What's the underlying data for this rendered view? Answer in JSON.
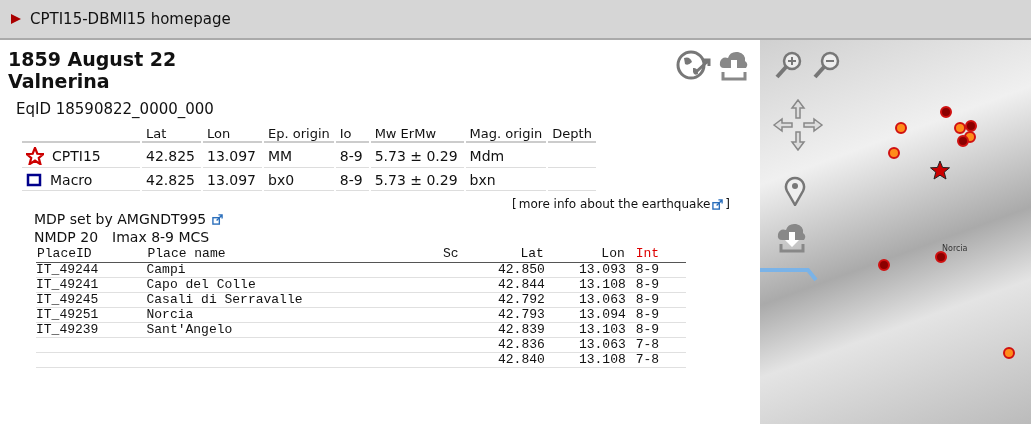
{
  "window": {
    "title": "CPTI15-DBMI15 homepage"
  },
  "event": {
    "date": "1859 August 22",
    "area": "Valnerina",
    "eqid": "EqID 18590822_0000_000"
  },
  "params": {
    "columns": [
      "Lat",
      "Lon",
      "Ep. origin",
      "Io",
      "Mw   ErMw",
      "Mag. origin",
      "Depth"
    ],
    "rows": [
      {
        "kind": "star",
        "name": "CPTI15",
        "cells": [
          "42.825",
          "13.097",
          "MM",
          "8-9",
          "5.73 ± 0.29",
          "Mdm",
          ""
        ]
      },
      {
        "kind": "square",
        "name": "Macro",
        "cells": [
          "42.825",
          "13.097",
          "bx0",
          "8-9",
          "5.73 ± 0.29",
          "bxn",
          ""
        ]
      }
    ]
  },
  "more_info": {
    "open": "[",
    "link": "more info about the earthquake",
    "close": "]"
  },
  "mdp": {
    "set_by": "MDP set by AMGNDT995",
    "nmdp": "NMDP 20",
    "imax": "Imax 8-9 MCS"
  },
  "places": {
    "columns": [
      "PlaceID",
      "Place name",
      "Sc",
      "Lat",
      "Lon",
      "Int"
    ],
    "rows": [
      {
        "id": "IT_49244",
        "name": "Campi",
        "lat": "42.850",
        "lon": "13.093",
        "int": "8-9"
      },
      {
        "id": "IT_49241",
        "name": "Capo del Colle",
        "lat": "42.844",
        "lon": "13.108",
        "int": "8-9"
      },
      {
        "id": "IT_49245",
        "name": "Casali di Serravalle",
        "lat": "42.792",
        "lon": "13.063",
        "int": "8-9"
      },
      {
        "id": "IT_49251",
        "name": "Norcia",
        "lat": "42.793",
        "lon": "13.094",
        "int": "8-9"
      },
      {
        "id": "IT_49239",
        "name": "Sant'Angelo",
        "lat": "42.839",
        "lon": "13.103",
        "int": "8-9"
      },
      {
        "id": "",
        "name": "",
        "lat": "42.836",
        "lon": "13.063",
        "int": "7-8"
      },
      {
        "id": "",
        "name": "",
        "lat": "42.840",
        "lon": "13.108",
        "int": "7-8"
      }
    ]
  },
  "map": {
    "place_label": "Norcia",
    "markers": [
      {
        "color": "#8b0000"
      },
      {
        "color": "#ff8c1a"
      },
      {
        "color": "#ff8c1a"
      },
      {
        "color": "#8b0000"
      },
      {
        "color": "#ff8c1a"
      },
      {
        "color": "#8b0000"
      },
      {
        "color": "#ff8c1a"
      },
      {
        "color": "#8b0000"
      },
      {
        "color": "#8b0000"
      },
      {
        "color": "#ff8c1a"
      }
    ]
  }
}
